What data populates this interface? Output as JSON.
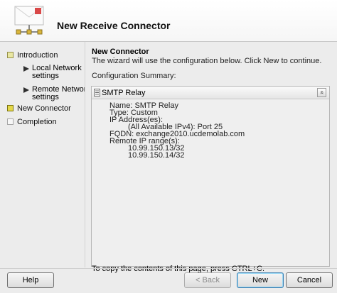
{
  "window": {
    "title": "New Receive Connector"
  },
  "sidebar": {
    "steps": [
      {
        "label": "Introduction",
        "state": "done"
      },
      {
        "label_lines": [
          "Local Network",
          "settings"
        ],
        "state": "done",
        "sub": true
      },
      {
        "label_lines": [
          "Remote Network",
          "settings"
        ],
        "state": "done",
        "sub": true
      },
      {
        "label": "New Connector",
        "state": "current"
      },
      {
        "label": "Completion",
        "state": "pending"
      }
    ]
  },
  "content": {
    "title": "New Connector",
    "subtitle": "The wizard will use the configuration below.  Click New to continue.",
    "summary_label": "Configuration Summary:",
    "summary": {
      "header": "SMTP Relay",
      "collapse_glyph": "»",
      "lines": [
        "Name: SMTP Relay",
        "Type: Custom",
        "IP Address(es):",
        "(All Available IPv4): Port 25",
        "FQDN: exchange2010.ucdemolab.com",
        "Remote IP range(s):",
        "10.99.150.13/32",
        "10.99.150.14/32"
      ]
    },
    "copy_hint": "To copy the contents of this page, press CTRL+C."
  },
  "buttons": {
    "help": "Help",
    "back": "< Back",
    "new": "New",
    "cancel": "Cancel"
  }
}
